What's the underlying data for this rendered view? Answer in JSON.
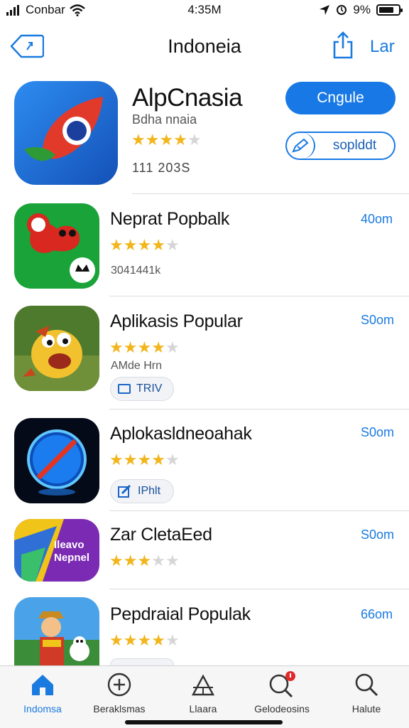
{
  "status_bar": {
    "carrier": "Conbar",
    "time": "4:35M",
    "battery": "9%"
  },
  "navbar": {
    "title": "Indoneia",
    "right_label": "Lar",
    "back_icon": "back-arrow-icon",
    "share_icon": "share-icon"
  },
  "featured": {
    "title": "AlpCnasia",
    "subtitle": "Bdha nnaia",
    "rating": 3.5,
    "meta": "111 203S",
    "primary_button": "Cngule",
    "secondary_button": "soplddt",
    "accent": "#1879e6"
  },
  "apps": [
    {
      "title": "Neprat Popbalk",
      "price": "40om",
      "rating": 3.5,
      "meta": "3041441k"
    },
    {
      "title": "Aplikasis Popular",
      "price": "S0om",
      "rating": 3.5,
      "meta": "AMde Hrn",
      "pill": "TRIV"
    },
    {
      "title": "Aplokasldneoahak",
      "price": "S0om",
      "rating": 3.5,
      "pill": "IPhlt"
    },
    {
      "title": "Zar CletaEed",
      "price": "S0om",
      "rating": 3,
      "icon_text_1": "Ileavo",
      "icon_text_2": "Nepnel"
    },
    {
      "title": "Pepdraial Populak",
      "price": "66om",
      "rating": 3.5
    }
  ],
  "tabbar": [
    {
      "label": "Indomsa",
      "icon": "home-icon",
      "active": true
    },
    {
      "label": "Beraklsmas",
      "icon": "plus-circle-icon",
      "active": false
    },
    {
      "label": "Llaara",
      "icon": "tent-icon",
      "active": false
    },
    {
      "label": "Gelodeosins",
      "icon": "search-badge-icon",
      "active": false
    },
    {
      "label": "Halute",
      "icon": "search-icon",
      "active": false
    }
  ]
}
